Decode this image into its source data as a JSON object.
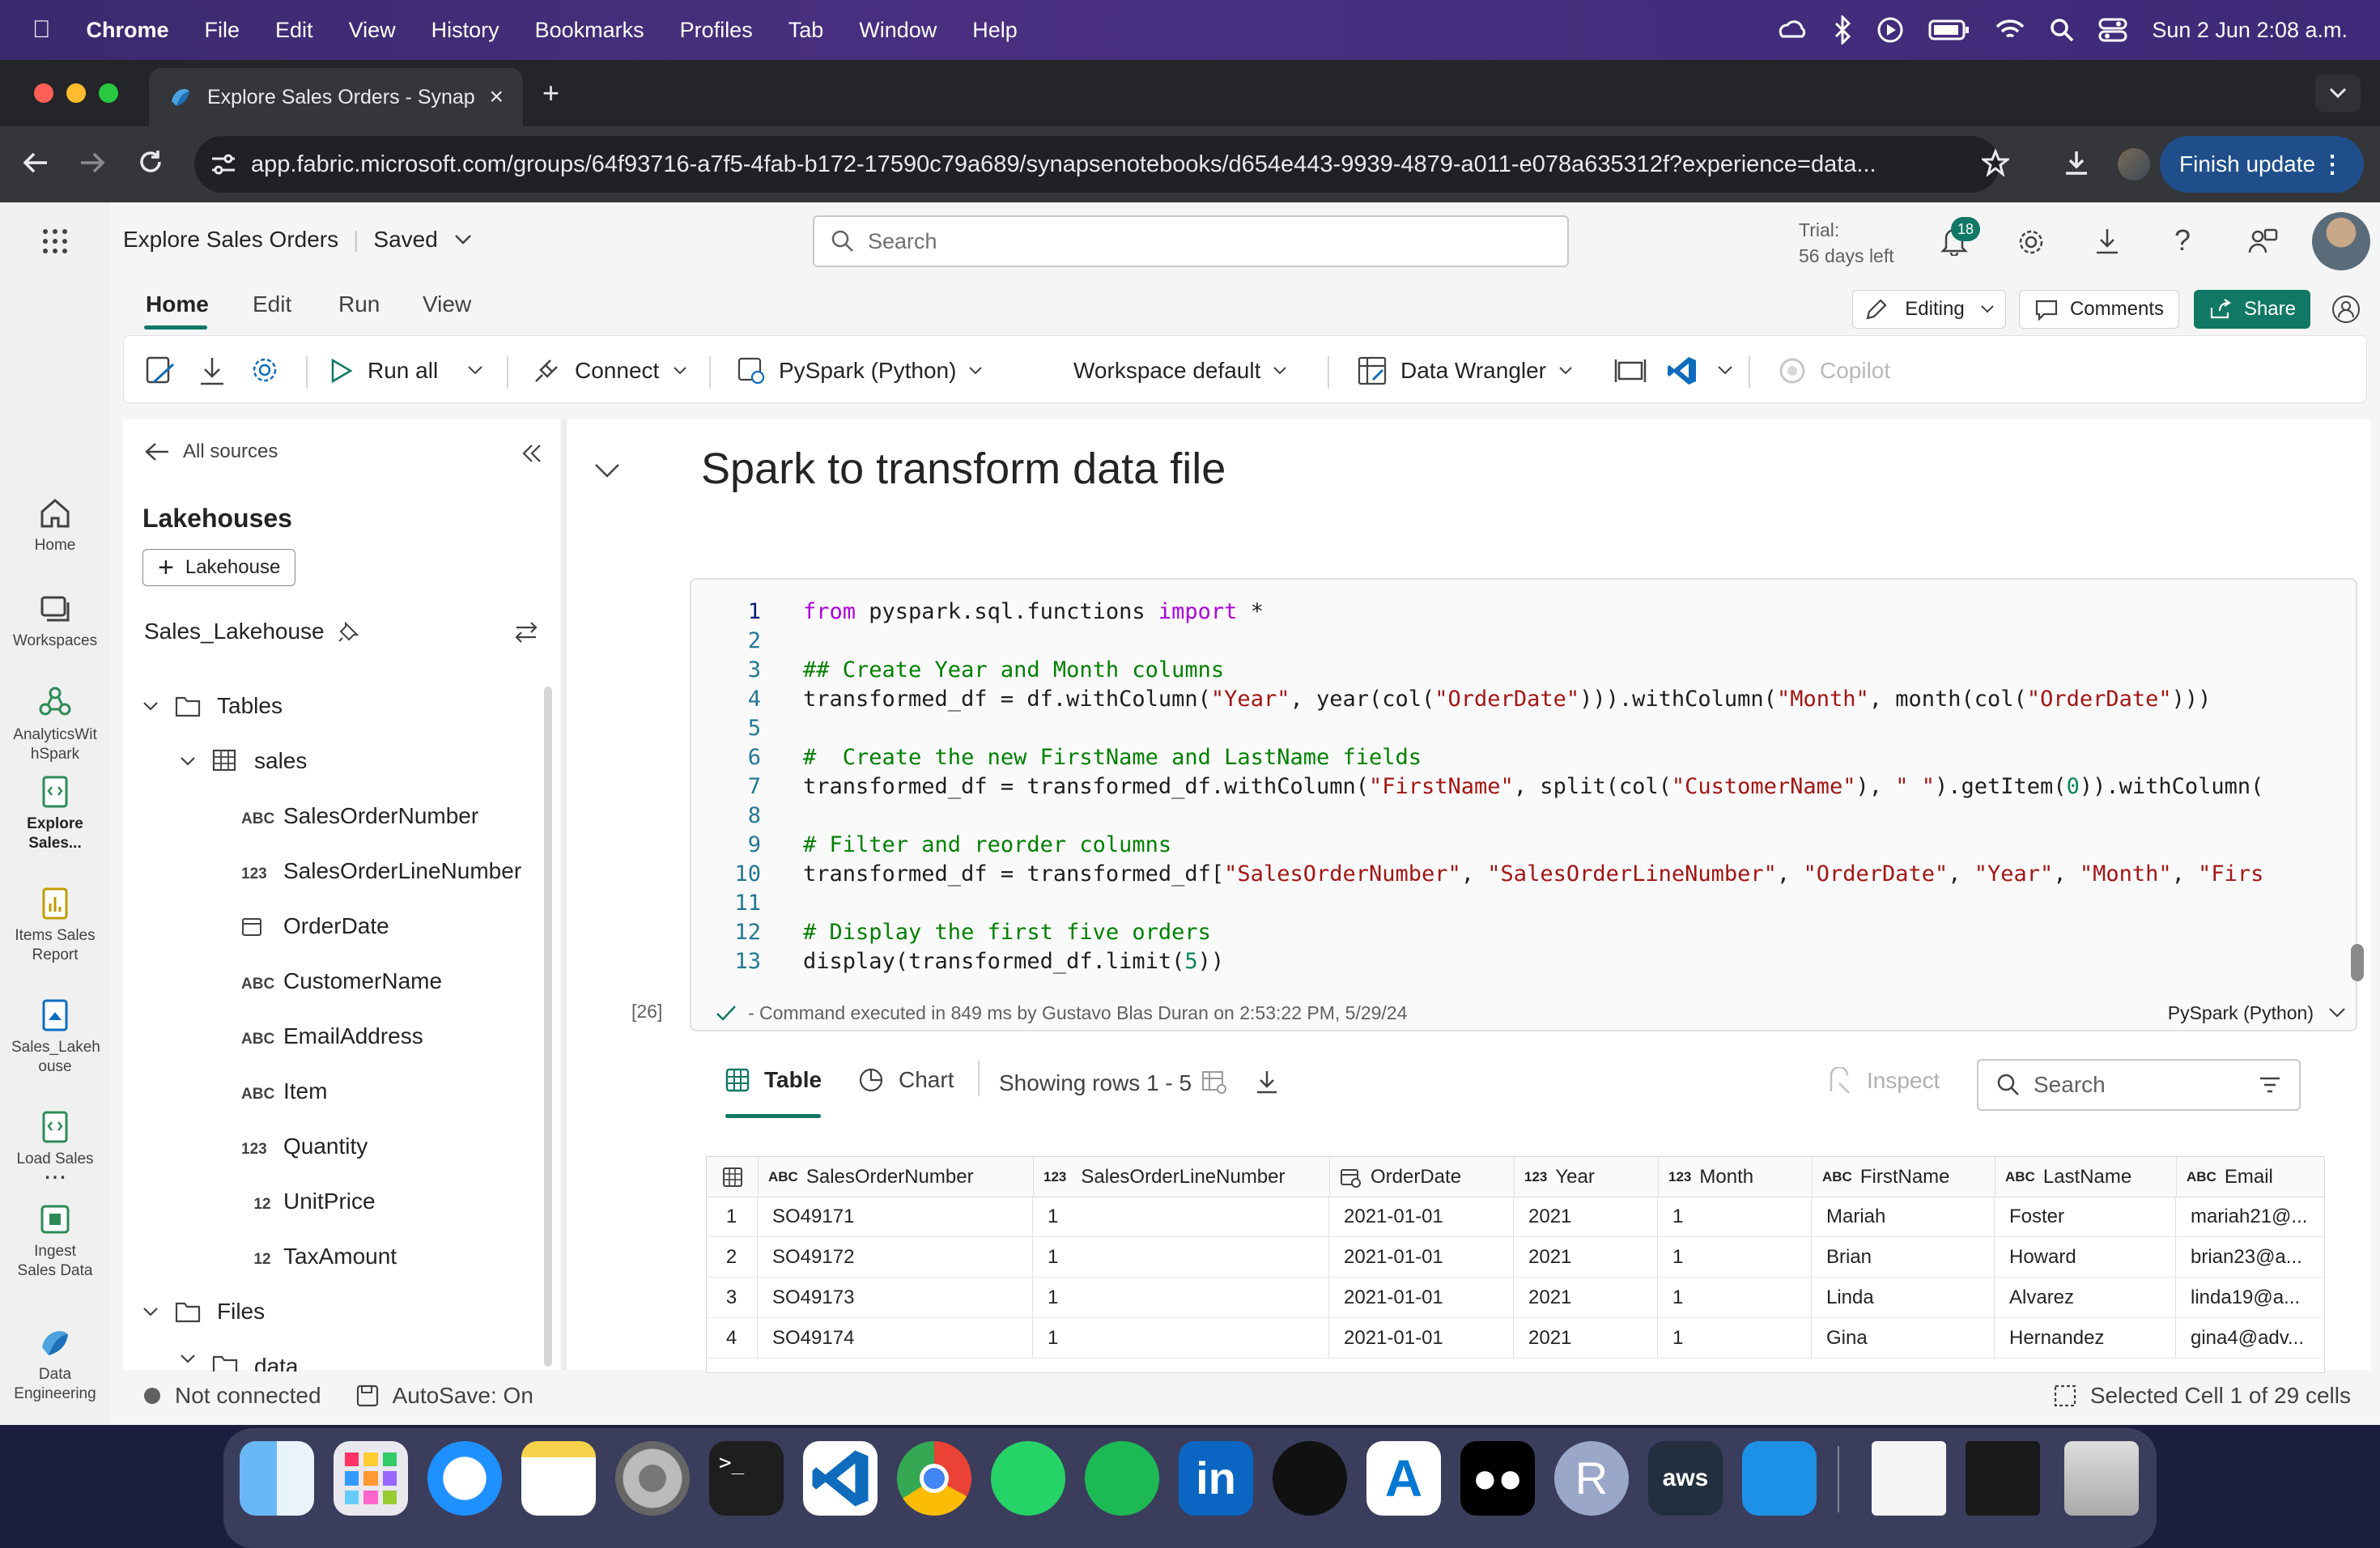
{
  "menubar": {
    "app": "Chrome",
    "items": [
      "File",
      "Edit",
      "View",
      "History",
      "Bookmarks",
      "Profiles",
      "Tab",
      "Window",
      "Help"
    ],
    "datetime": "Sun 2 Jun  2:08 a.m."
  },
  "browser": {
    "tab_title": "Explore Sales Orders - Synap",
    "url": "app.fabric.microsoft.com/groups/64f93716-a7f5-4fab-b172-17590c79a689/synapsenotebooks/d654e443-9939-4879-a011-e078a635312f?experience=data...",
    "finish_update": "Finish update"
  },
  "header": {
    "doc_title": "Explore Sales Orders",
    "saved": "Saved",
    "search_placeholder": "Search",
    "trial_line1": "Trial:",
    "trial_line2": "56 days left",
    "notif_count": "18"
  },
  "leftnav": [
    {
      "label": "Home",
      "icon": "home-icon"
    },
    {
      "label": "Workspaces",
      "icon": "workspaces-icon"
    },
    {
      "label": "AnalyticsWit hSpark",
      "icon": "analytics-icon"
    },
    {
      "label": "Explore Sales...",
      "icon": "notebook-icon"
    },
    {
      "label": "Items Sales Report",
      "icon": "report-icon"
    },
    {
      "label": "Sales_Lakeh ouse",
      "icon": "lakehouse-icon"
    },
    {
      "label": "Load Sales",
      "icon": "notebook-icon"
    },
    {
      "label": "Ingest Sales Data",
      "icon": "pipeline-icon"
    },
    {
      "label": "...",
      "icon": "more-icon"
    },
    {
      "label": "Data Engineering",
      "icon": "data-engineering-icon"
    }
  ],
  "ribbon": {
    "tabs": [
      "Home",
      "Edit",
      "Run",
      "View"
    ],
    "editing": "Editing",
    "comments": "Comments",
    "share": "Share",
    "run_all": "Run all",
    "connect": "Connect",
    "language": "PySpark (Python)",
    "environment": "Workspace default",
    "data_wrangler": "Data Wrangler",
    "copilot": "Copilot"
  },
  "explorer": {
    "back": "All sources",
    "section": "Lakehouses",
    "add_button": "Lakehouse",
    "lakehouse_name": "Sales_Lakehouse",
    "tables_label": "Tables",
    "table_name": "sales",
    "columns": [
      {
        "tag": "ABC",
        "name": "SalesOrderNumber"
      },
      {
        "tag": "123",
        "name": "SalesOrderLineNumber"
      },
      {
        "tag": "",
        "name": "OrderDate"
      },
      {
        "tag": "ABC",
        "name": "CustomerName"
      },
      {
        "tag": "ABC",
        "name": "EmailAddress"
      },
      {
        "tag": "ABC",
        "name": "Item"
      },
      {
        "tag": "123",
        "name": "Quantity"
      },
      {
        "tag": "12",
        "name": "UnitPrice"
      },
      {
        "tag": "12",
        "name": "TaxAmount"
      }
    ],
    "files_label": "Files",
    "data_folder": "data"
  },
  "notebook": {
    "heading": "Spark to transform data file",
    "line_numbers": [
      "1",
      "2",
      "3",
      "4",
      "5",
      "6",
      "7",
      "8",
      "9",
      "10",
      "11",
      "12",
      "13"
    ],
    "exec_count": "[26]",
    "exec_info": "- Command executed in 849 ms by Gustavo Blas Duran on 2:53:22 PM, 5/29/24",
    "cell_lang": "PySpark (Python)"
  },
  "output": {
    "table_tab": "Table",
    "chart_tab": "Chart",
    "rows_info": "Showing rows 1 - 5",
    "inspect": "Inspect",
    "search_placeholder": "Search",
    "headers": [
      {
        "tag": "ABC",
        "name": "SalesOrderNumber"
      },
      {
        "tag": "123",
        "name": "SalesOrderLineNumber"
      },
      {
        "tag": "",
        "name": "OrderDate"
      },
      {
        "tag": "123",
        "name": "Year"
      },
      {
        "tag": "123",
        "name": "Month"
      },
      {
        "tag": "ABC",
        "name": "FirstName"
      },
      {
        "tag": "ABC",
        "name": "LastName"
      },
      {
        "tag": "ABC",
        "name": "Email"
      }
    ],
    "rows": [
      [
        "1",
        "SO49171",
        "1",
        "2021-01-01",
        "2021",
        "1",
        "Mariah",
        "Foster",
        "mariah21@..."
      ],
      [
        "2",
        "SO49172",
        "1",
        "2021-01-01",
        "2021",
        "1",
        "Brian",
        "Howard",
        "brian23@a..."
      ],
      [
        "3",
        "SO49173",
        "1",
        "2021-01-01",
        "2021",
        "1",
        "Linda",
        "Alvarez",
        "linda19@a..."
      ],
      [
        "4",
        "SO49174",
        "1",
        "2021-01-01",
        "2021",
        "1",
        "Gina",
        "Hernandez",
        "gina4@adv..."
      ]
    ]
  },
  "status": {
    "connection": "Not connected",
    "autosave": "AutoSave: On",
    "selected": "Selected Cell 1 of 29 cells"
  },
  "colors": {
    "accent": "#117865",
    "brand_blue": "#0f6cbd",
    "menubar": "#3a2a6e"
  }
}
